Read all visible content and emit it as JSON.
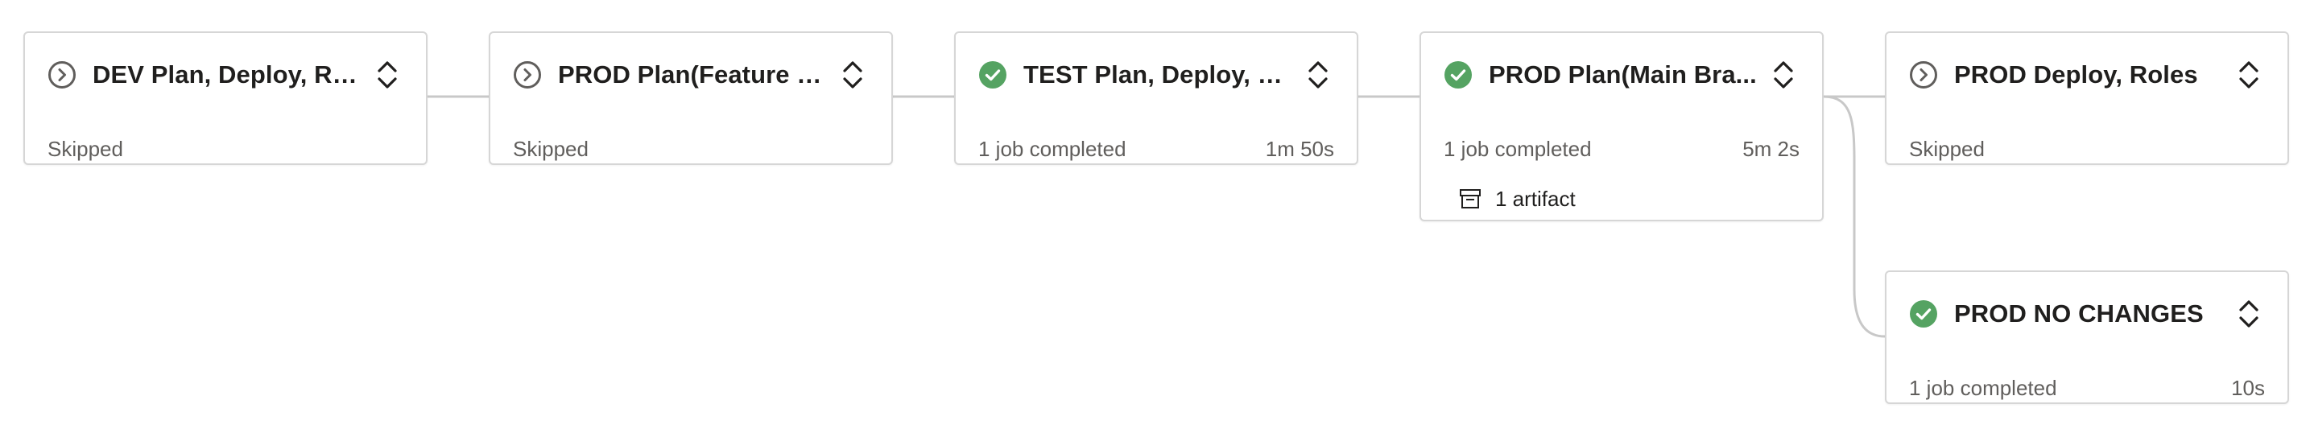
{
  "pipeline": {
    "stages": [
      {
        "id": "dev",
        "status": "skipped",
        "title": "DEV Plan, Deploy, Rol...",
        "info": "Skipped",
        "duration": "",
        "artifact": ""
      },
      {
        "id": "prod-feature",
        "status": "skipped",
        "title": "PROD Plan(Feature B...",
        "info": "Skipped",
        "duration": "",
        "artifact": ""
      },
      {
        "id": "test",
        "status": "succeeded",
        "title": "TEST Plan, Deploy, R...",
        "info": "1 job completed",
        "duration": "1m 50s",
        "artifact": ""
      },
      {
        "id": "prod-main",
        "status": "succeeded",
        "title": "PROD Plan(Main Bra...",
        "info": "1 job completed",
        "duration": "5m 2s",
        "artifact": "1 artifact"
      },
      {
        "id": "prod-deploy",
        "status": "skipped",
        "title": "PROD Deploy, Roles",
        "info": "Skipped",
        "duration": "",
        "artifact": ""
      },
      {
        "id": "prod-no-changes",
        "status": "succeeded",
        "title": "PROD NO CHANGES",
        "info": "1 job completed",
        "duration": "10s",
        "artifact": ""
      }
    ],
    "icons": {
      "succeeded": "check-circle-icon",
      "skipped": "chevron-right-circle-icon",
      "expand": "expand-collapse-icon",
      "artifact": "artifact-icon"
    },
    "colors": {
      "success": "#55a362",
      "skipped": "#605e5c",
      "border": "#d6d6d6",
      "connector": "#c8c8c8"
    }
  }
}
